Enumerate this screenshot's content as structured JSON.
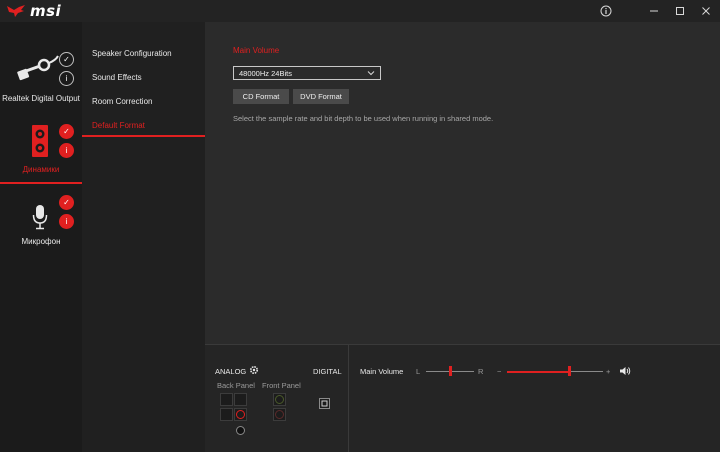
{
  "app": {
    "logo_text": "msi"
  },
  "window": {
    "info_glyph": "ⓘ",
    "minimize_glyph": "—",
    "maximize_glyph": "☐",
    "close_glyph": "✕"
  },
  "devices": [
    {
      "label": "Realtek Digital Output",
      "icon": "digital-plug-icon",
      "active": false
    },
    {
      "label": "Динамики",
      "icon": "speaker-icon",
      "active": true
    },
    {
      "label": "Микрофон",
      "icon": "microphone-icon",
      "active": false
    }
  ],
  "menu": {
    "items": [
      {
        "label": "Speaker Configuration",
        "active": false
      },
      {
        "label": "Sound Effects",
        "active": false
      },
      {
        "label": "Room Correction",
        "active": false
      },
      {
        "label": "Default Format",
        "active": true
      }
    ]
  },
  "main": {
    "title": "Main Volume",
    "format_select": {
      "value": "48000Hz 24Bits"
    },
    "cd_button": "CD Format",
    "dvd_button": "DVD Format",
    "description": "Select the sample rate and bit depth to be used when running in shared mode."
  },
  "bottom": {
    "analog_label": "ANALOG",
    "digital_label": "DIGITAL",
    "back_panel_label": "Back Panel",
    "front_panel_label": "Front Panel",
    "volume_label": "Main Volume",
    "balance_left": "L",
    "balance_right": "R",
    "minus": "−",
    "plus": "+",
    "balance_value": 0.5,
    "volume_value": 0.65
  },
  "colors": {
    "accent": "#e02020",
    "background": "#2b2b2b",
    "sidebar": "#1b1b1b"
  }
}
